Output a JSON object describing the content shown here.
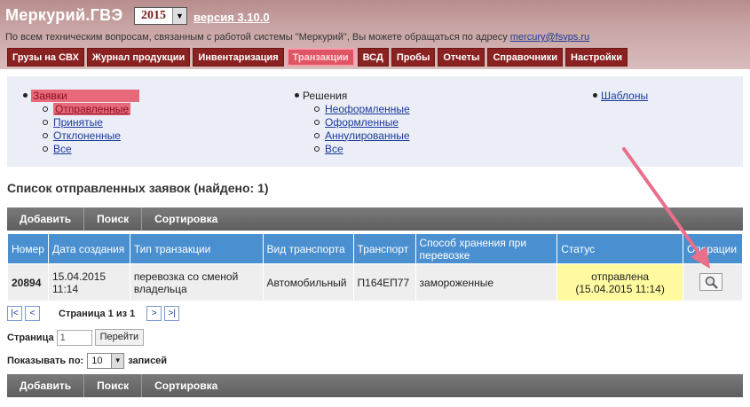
{
  "header": {
    "brand": "Меркурий",
    "brand_suffix": ".ГВЭ",
    "year": "2015",
    "version": "версия 3.10.0",
    "support_text": "По всем техническим вопросам, связанным с работой системы \"Меркурий\", Вы можете обращаться по адресу",
    "support_email": "mercury@fsvps.ru"
  },
  "nav": {
    "tabs": [
      {
        "label": "Грузы на СВХ"
      },
      {
        "label": "Журнал продукции"
      },
      {
        "label": "Инвентаризация"
      },
      {
        "label": "Транзакции"
      },
      {
        "label": "ВСД"
      },
      {
        "label": "Пробы"
      },
      {
        "label": "Отчеты"
      },
      {
        "label": "Справочники"
      },
      {
        "label": "Настройки"
      }
    ]
  },
  "subnav": {
    "requests": {
      "label": "Заявки",
      "items": [
        "Отправленные",
        "Принятые",
        "Отклоненные",
        "Все"
      ]
    },
    "decisions": {
      "label": "Решения",
      "items": [
        "Неоформленные",
        "Оформленные",
        "Аннулированные",
        "Все"
      ]
    },
    "templates": {
      "label": "Шаблоны"
    }
  },
  "page_title": "Список отправленных заявок (найдено: 1)",
  "toolbar": {
    "add": "Добавить",
    "search": "Поиск",
    "sort": "Сортировка"
  },
  "table": {
    "headers": [
      "Номер",
      "Дата создания",
      "Тип транзакции",
      "Вид транспорта",
      "Транспорт",
      "Способ хранения при перевозке",
      "Статус",
      "Операции"
    ],
    "rows": [
      {
        "number": "20894",
        "date": "15.04.2015",
        "time": "11:14",
        "type": "перевозка со сменой владельца",
        "transport_kind": "Автомобильный",
        "transport": "П164ЕП77",
        "storage": "замороженные",
        "status": "отправлена",
        "status_date": "(15.04.2015 11:14)"
      }
    ]
  },
  "pager": {
    "first": "|<",
    "prev": "<",
    "next": ">",
    "last": ">|",
    "page_text": "Страница 1 из 1",
    "page_label": "Страница",
    "page_value": "1",
    "go_button": "Перейти",
    "show_label": "Показывать по:",
    "show_value": "10",
    "records_label": "записей"
  },
  "colors": {
    "accent": "#8a2222",
    "header_bg": "#c9a4a4",
    "table_header": "#4a8fd0",
    "status_highlight": "#fffaa0",
    "annotation_arrow": "#e8708a"
  }
}
